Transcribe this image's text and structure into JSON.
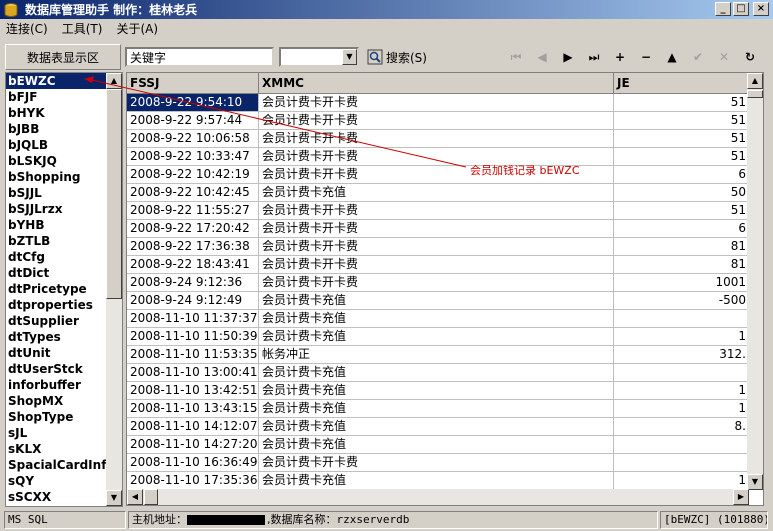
{
  "window": {
    "title": "数据库管理助手  制作：桂林老兵"
  },
  "menu": {
    "items": [
      "连接(C)",
      "工具(T)",
      "关于(A)"
    ]
  },
  "toolbar": {
    "table_area_label": "数据表显示区",
    "keyword_value": "关键字",
    "combo_value": "",
    "search_label": "搜索(S)",
    "nav": [
      "⏮",
      "◀",
      "▶",
      "⏭",
      "+",
      "−",
      "▲",
      "✔",
      "✕",
      "↻"
    ]
  },
  "tables": {
    "selected": "bEWZC",
    "items": [
      "bEWZC",
      "bFJF",
      "bHYK",
      "bJBB",
      "bJQLB",
      "bLSKJQ",
      "bShopping",
      "bSJJL",
      "bSJJLrzx",
      "bYHB",
      "bZTLB",
      "dtCfg",
      "dtDict",
      "dtPricetype",
      "dtproperties",
      "dtSupplier",
      "dtTypes",
      "dtUnit",
      "dtUserStck",
      "inforbuffer",
      "ShopMX",
      "ShopType",
      "sJL",
      "sKLX",
      "SpacialCardInfo",
      "sQY",
      "sSCXX"
    ]
  },
  "grid": {
    "columns": [
      "FSSJ",
      "XMMC",
      "JE"
    ],
    "rows": [
      [
        "2008-9-22 9:54:10",
        "会员计费卡开卡费",
        "51"
      ],
      [
        "2008-9-22 9:57:44",
        "会员计费卡开卡费",
        "51"
      ],
      [
        "2008-9-22 10:06:58",
        "会员计费卡开卡费",
        "51"
      ],
      [
        "2008-9-22 10:33:47",
        "会员计费卡开卡费",
        "51"
      ],
      [
        "2008-9-22 10:42:19",
        "会员计费卡开卡费",
        "6"
      ],
      [
        "2008-9-22 10:42:45",
        "会员计费卡充值",
        "50"
      ],
      [
        "2008-9-22 11:55:27",
        "会员计费卡开卡费",
        "51"
      ],
      [
        "2008-9-22 17:20:42",
        "会员计费卡开卡费",
        "6"
      ],
      [
        "2008-9-22 17:36:38",
        "会员计费卡开卡费",
        "81"
      ],
      [
        "2008-9-22 18:43:41",
        "会员计费卡开卡费",
        "81"
      ],
      [
        "2008-9-24 9:12:36",
        "会员计费卡开卡费",
        "1001"
      ],
      [
        "2008-9-24 9:12:49",
        "会员计费卡充值",
        "-500"
      ],
      [
        "2008-11-10 11:37:37",
        "会员计费卡充值",
        ""
      ],
      [
        "2008-11-10 11:50:39",
        "会员计费卡充值",
        "1"
      ],
      [
        "2008-11-10 11:53:35",
        "帐务冲正",
        "312."
      ],
      [
        "2008-11-10 13:00:41",
        "会员计费卡充值",
        ""
      ],
      [
        "2008-11-10 13:42:51",
        "会员计费卡充值",
        "1"
      ],
      [
        "2008-11-10 13:43:15",
        "会员计费卡充值",
        "1"
      ],
      [
        "2008-11-10 14:12:07",
        "会员计费卡充值",
        "8."
      ],
      [
        "2008-11-10 14:27:20",
        "会员计费卡充值",
        ""
      ],
      [
        "2008-11-10 16:36:49",
        "会员计费卡开卡费",
        ""
      ],
      [
        "2008-11-10 17:35:36",
        "会员计费卡充值",
        "1"
      ]
    ]
  },
  "annotation": {
    "text": "会员加钱记录 bEWZC",
    "color": "#cc0000"
  },
  "status": {
    "db_type": "MS SQL",
    "host_label": "主机地址：",
    "db_label": ",数据库名称：",
    "db_name": "rzxserverdb",
    "table_info": "[bEWZC] (101880)"
  },
  "colors": {
    "titlebar": "#0a246a",
    "selection": "#0a246a",
    "face": "#d4d0c8"
  }
}
